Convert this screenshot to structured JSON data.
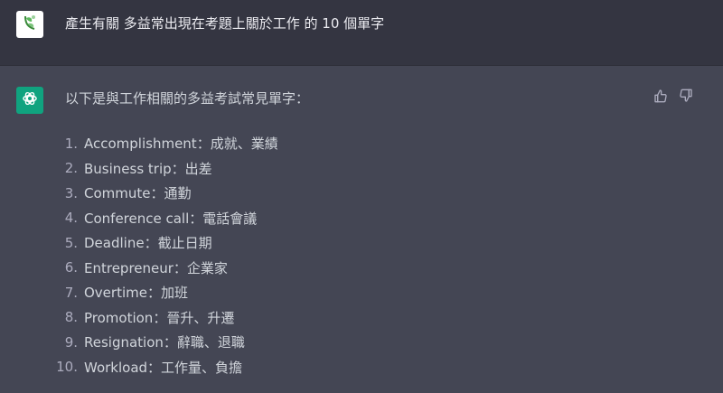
{
  "user": {
    "avatar_icon": "leaf-logo-icon",
    "prompt": "產生有關 多益常出現在考題上關於工作 的 10 個單字"
  },
  "assistant": {
    "avatar_icon": "openai-logo-icon",
    "intro": "以下是與工作相關的多益考試常見單字：",
    "feedback": {
      "like_icon": "thumbs-up-icon",
      "dislike_icon": "thumbs-down-icon"
    },
    "items": [
      {
        "num": "1.",
        "text": "Accomplishment：成就、業績"
      },
      {
        "num": "2.",
        "text": "Business trip：出差"
      },
      {
        "num": "3.",
        "text": "Commute：通勤"
      },
      {
        "num": "4.",
        "text": "Conference call：電話會議"
      },
      {
        "num": "5.",
        "text": "Deadline：截止日期"
      },
      {
        "num": "6.",
        "text": "Entrepreneur：企業家"
      },
      {
        "num": "7.",
        "text": "Overtime：加班"
      },
      {
        "num": "8.",
        "text": "Promotion：晉升、升遷"
      },
      {
        "num": "9.",
        "text": "Resignation：辭職、退職"
      },
      {
        "num": "10.",
        "text": "Workload：工作量、負擔"
      }
    ]
  },
  "colors": {
    "user_bg": "#343541",
    "assistant_bg": "#444654",
    "brand_green": "#10a37f",
    "text": "#d1d5db"
  }
}
